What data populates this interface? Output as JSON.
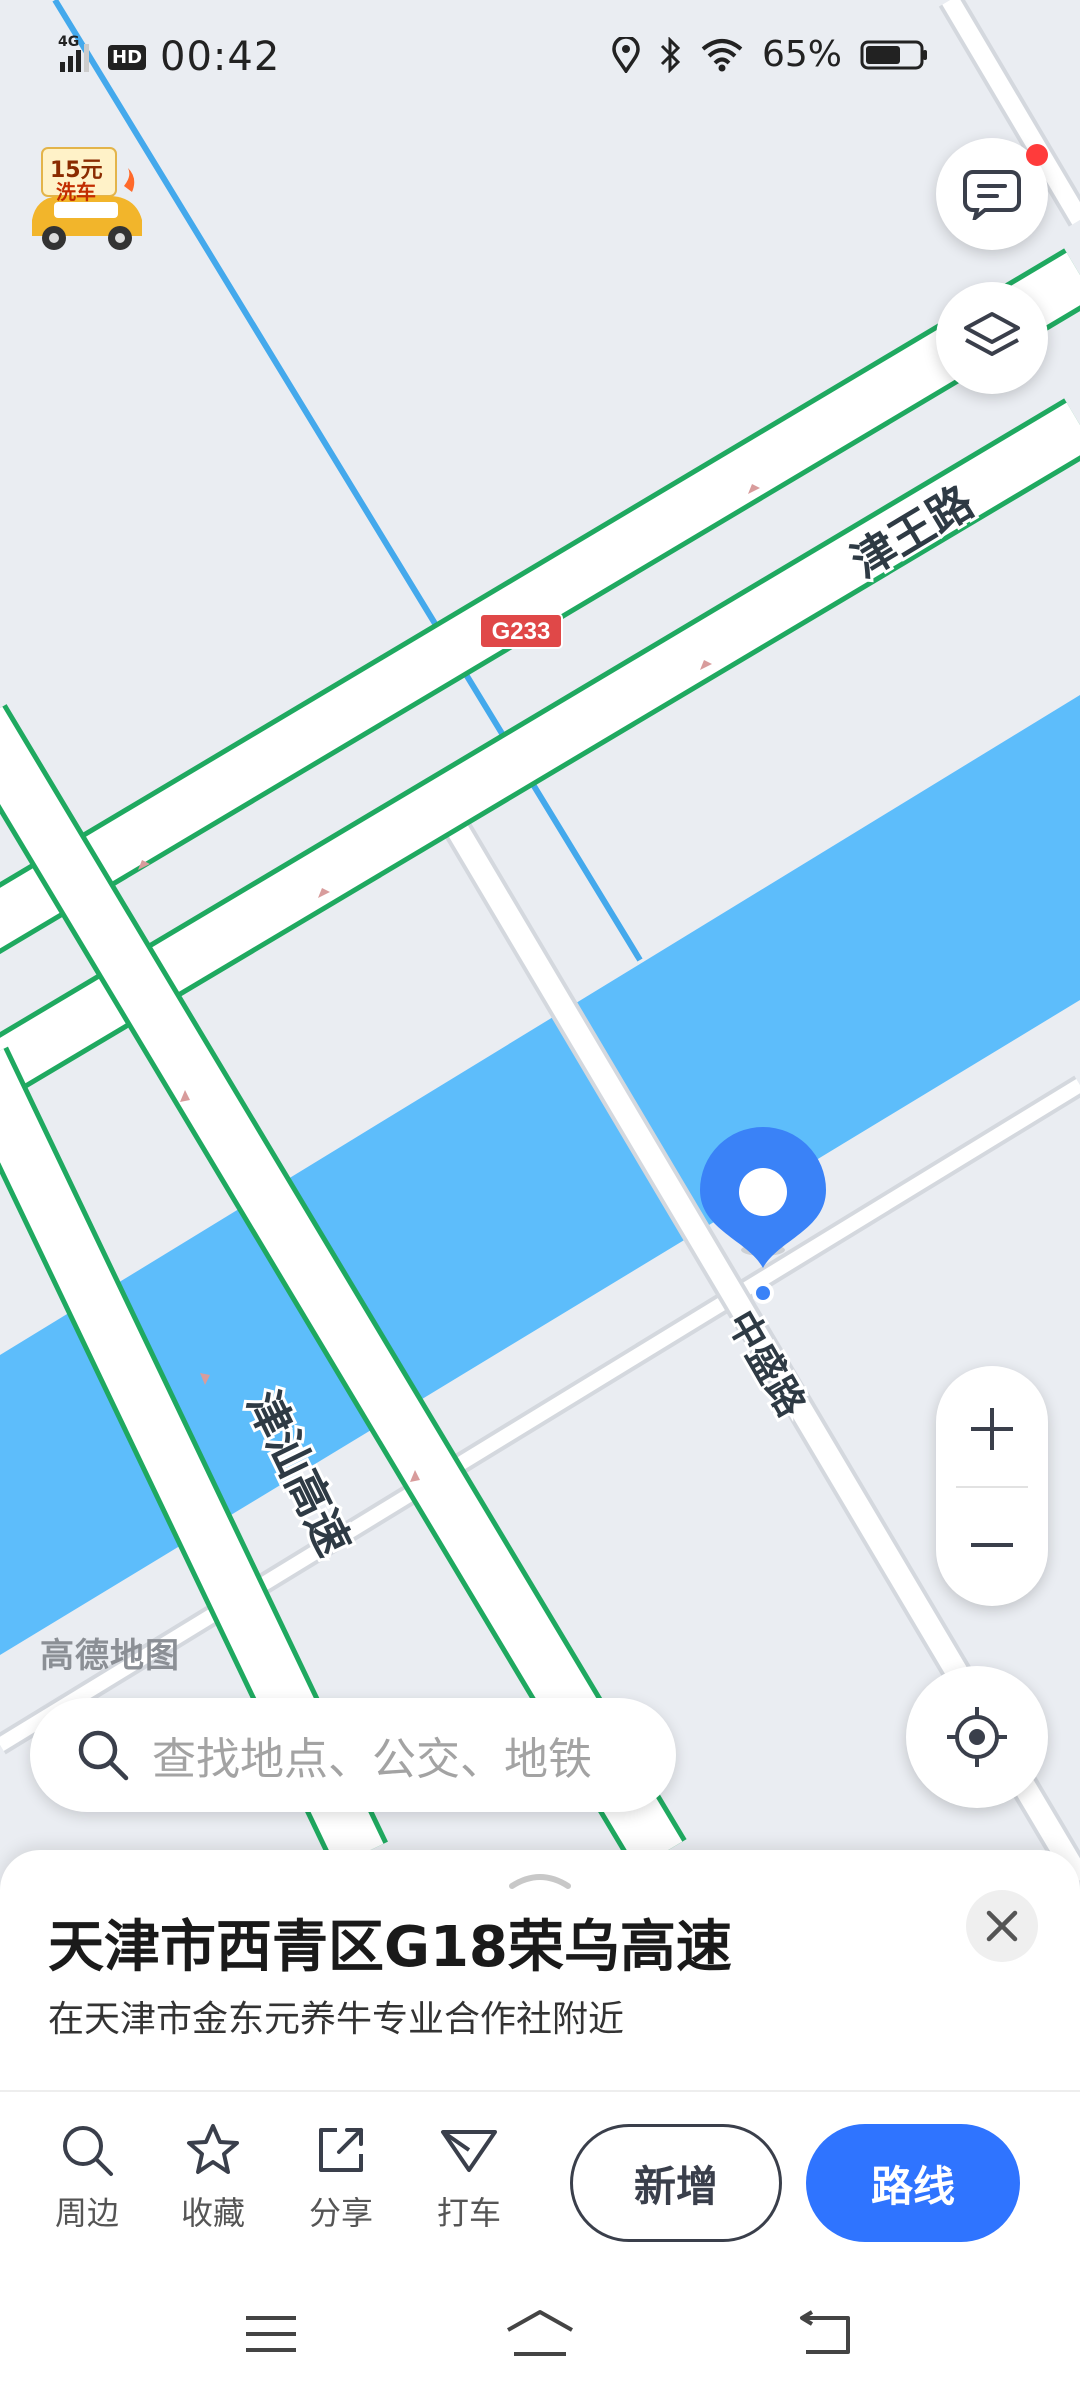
{
  "status_bar": {
    "network_label": "4G",
    "hd_label": "HD",
    "time": "00:42",
    "battery_percent": "65%",
    "battery_level": 0.65
  },
  "promo_badge": {
    "price": "15元",
    "text": "洗车"
  },
  "map": {
    "road_labels": {
      "jinwang_road": "津王路",
      "g233_shield": "G233",
      "zhongsheng_road": "中盛路",
      "jinshan_expressway": "津汕高速"
    },
    "watermark": "高德地图",
    "colors": {
      "land": "#eaedf2",
      "water": "#5dbdfb",
      "highway_edge": "#1fa960",
      "road": "#ffffff",
      "rail": "#44a9ec",
      "pin": "#3a82f7"
    }
  },
  "search": {
    "placeholder": "查找地点、公交、地铁"
  },
  "place_card": {
    "title": "天津市西青区G18荣乌高速",
    "subtitle": "在天津市金东元养牛专业合作社附近",
    "actions": [
      {
        "label": "周边",
        "icon": "search-icon"
      },
      {
        "label": "收藏",
        "icon": "star-icon"
      },
      {
        "label": "分享",
        "icon": "share-icon"
      },
      {
        "label": "打车",
        "icon": "taxi-icon"
      }
    ],
    "add_button": "新增",
    "route_button": "路线"
  }
}
